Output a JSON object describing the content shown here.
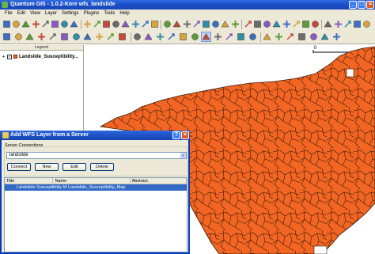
{
  "window": {
    "title": "Quantum GIS - 1.0.2-Kore wfs_landslide",
    "controls": [
      "_",
      "□",
      "×"
    ]
  },
  "menubar": [
    "File",
    "Edit",
    "View",
    "Layer",
    "Settings",
    "Plugins",
    "Tools",
    "Help"
  ],
  "toolbar_icons": {
    "row1": [
      "new-project",
      "open-project",
      "save-project",
      "save-as",
      "print",
      "add-vector-layer",
      "add-raster-layer",
      "add-postgis-layer",
      "add-wms-layer",
      "new-vector-layer",
      "remove-layer",
      "overview",
      "show-all",
      "hide-all",
      "toggle-editing",
      "capture-point",
      "capture-line",
      "capture-polygon",
      "move-feature",
      "split-feature",
      "delete-selected",
      "cut",
      "copy",
      "paste",
      "identify",
      "select",
      "measure",
      "annotation",
      "north-arrow",
      "scale-bar",
      "copyright",
      "grass",
      "python",
      "georeferencer",
      "gps",
      "table",
      "help"
    ],
    "row2": [
      "pencil",
      "node-tool",
      "add-ring",
      "add-island",
      "delete-vertex",
      "move-vertex",
      "simplify",
      "delete-ring",
      "delete-part",
      "reshape",
      "merge",
      "label",
      "rotate-label",
      "attribute-table",
      "map-tips",
      "new-bookmark",
      "show-bookmarks",
      "pan",
      "zoom-in",
      "zoom-out",
      "zoom-full",
      "zoom-selection",
      "zoom-layer",
      "zoom-last",
      "refresh",
      "identify-features",
      "measure-line",
      "measure-area",
      "tips"
    ]
  },
  "legend": {
    "header": "Legend",
    "layer": {
      "expander": "+",
      "checked": true,
      "name": "Landslide_Susceptibility..."
    }
  },
  "map": {
    "scalebar_label": "0",
    "fill_color": "#f26522",
    "line_color": "#3a1a0a"
  },
  "dialog": {
    "title": "Add WFS Layer from a Server",
    "group_label": "Server Connections",
    "connection_value": "landslide",
    "buttons": {
      "connect": "Connect",
      "new": "New",
      "edit": "Edit",
      "delete": "Delete"
    },
    "table": {
      "headers": [
        "Title",
        "Name",
        "Abstract"
      ],
      "rows": [
        [
          "",
          "Landslide Susceptibility Map",
          "Landslide_Susceptibility_Map",
          ""
        ]
      ]
    }
  }
}
